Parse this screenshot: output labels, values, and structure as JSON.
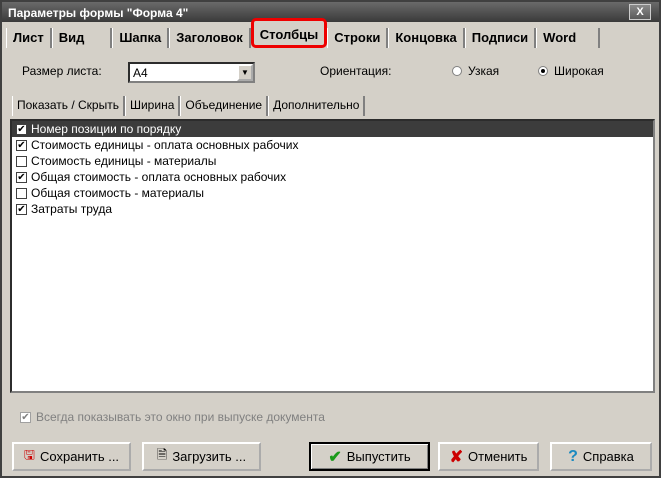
{
  "window": {
    "title": "Параметры формы \"Форма 4\"",
    "close": "X"
  },
  "tabs": [
    "Лист",
    "Вид",
    "Шапка",
    "Заголовок",
    "Столбцы",
    "Строки",
    "Концовка",
    "Подписи",
    "Word"
  ],
  "sheet": {
    "size_label": "Размер листа:",
    "size_value": "A4",
    "orientation_label": "Ориентация:",
    "portrait": "Узкая",
    "landscape": "Широкая",
    "selected": "Широкая"
  },
  "subtabs": [
    "Показать / Скрыть",
    "Ширина",
    "Объединение",
    "Дополнительно"
  ],
  "columns": [
    {
      "label": "Номер позиции по порядку",
      "checked": true
    },
    {
      "label": "Стоимость единицы - оплата основных рабочих",
      "checked": true
    },
    {
      "label": "Стоимость единицы - материалы",
      "checked": false
    },
    {
      "label": "Общая стоимость - оплата основных рабочих",
      "checked": true
    },
    {
      "label": "Общая стоимость - материалы",
      "checked": false
    },
    {
      "label": "Затраты труда",
      "checked": true
    }
  ],
  "always_show": "Всегда показывать это окно при выпуске документа",
  "buttons": {
    "save": "Сохранить ...",
    "load": "Загрузить ...",
    "run": "Выпустить",
    "cancel": "Отменить",
    "help": "Справка"
  }
}
